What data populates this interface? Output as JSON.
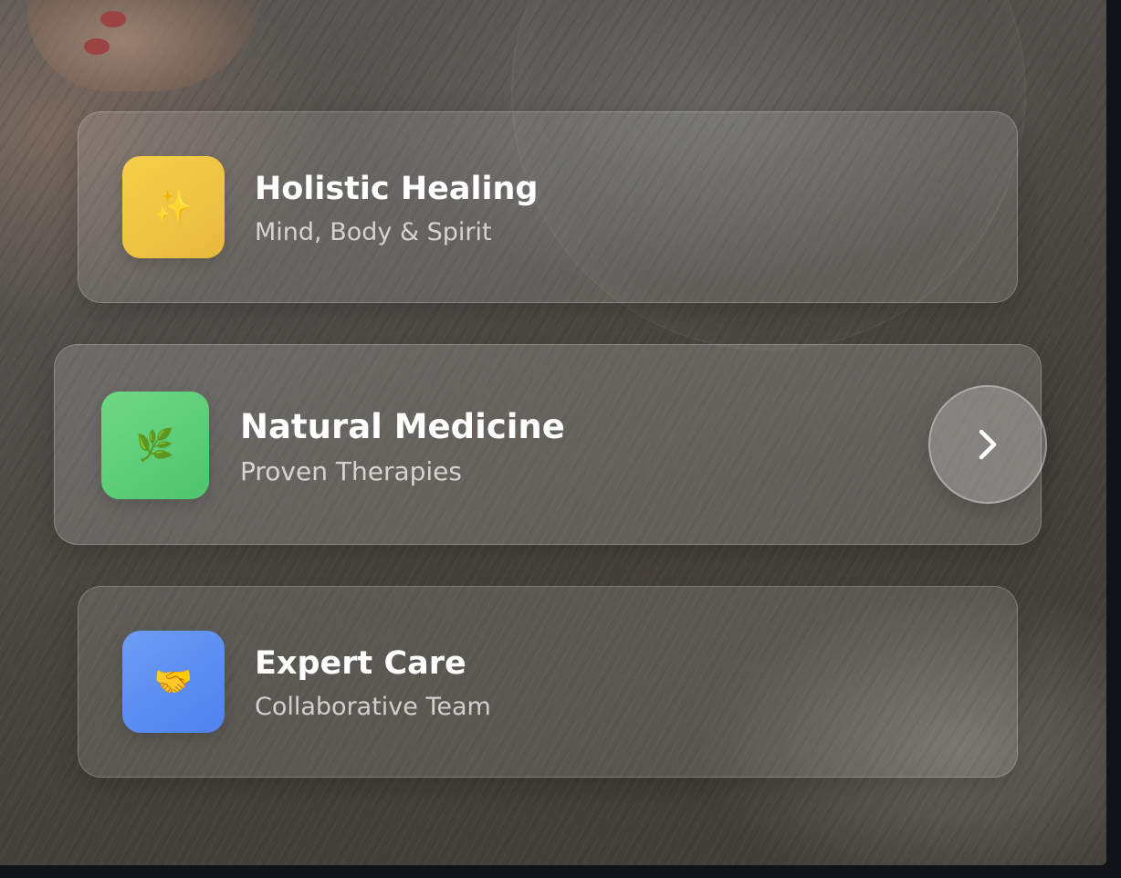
{
  "features": [
    {
      "icon": "sparkles-icon",
      "glyph": "✨",
      "accent": "#F2C94C",
      "title": "Holistic Healing",
      "subtitle": "Mind, Body & Spirit"
    },
    {
      "icon": "herb-icon",
      "glyph": "🌿",
      "accent": "#5FCF78",
      "title": "Natural Medicine",
      "subtitle": "Proven Therapies"
    },
    {
      "icon": "handshake-icon",
      "glyph": "🤝",
      "accent": "#5B8DF0",
      "title": "Expert Care",
      "subtitle": "Collaborative Team"
    }
  ],
  "next_button": {
    "icon": "chevron-right-icon",
    "glyph": "›"
  }
}
